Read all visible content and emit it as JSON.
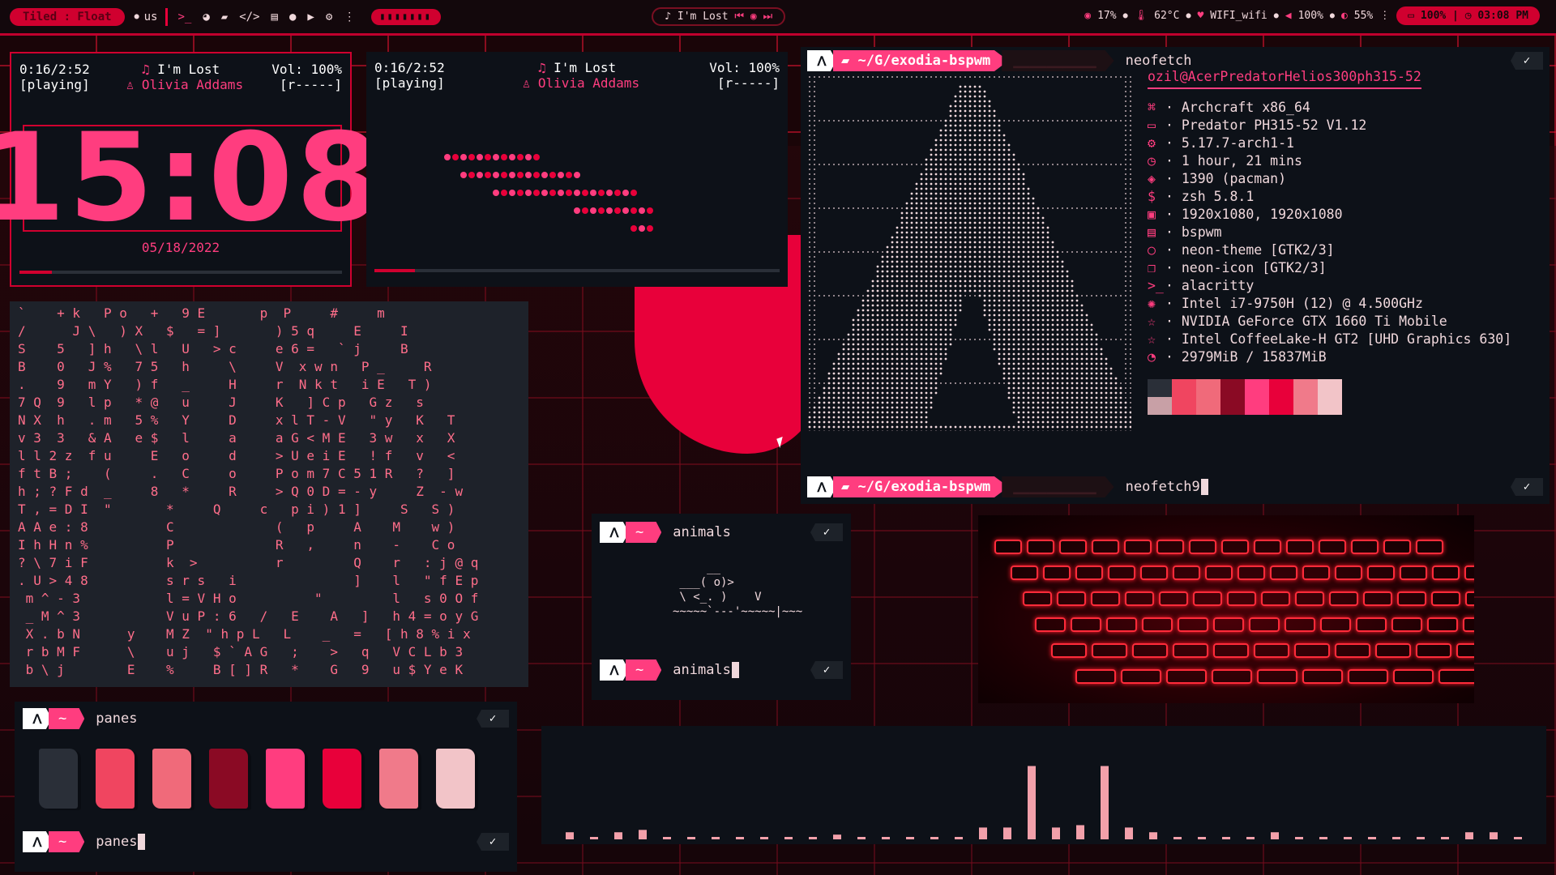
{
  "colors": {
    "accent": "#ff3d7f",
    "red": "#d0002f",
    "bg": "#0d1118"
  },
  "topbar": {
    "layout": "Tiled : Float",
    "kbd_layout": "us",
    "icons": [
      "terminal-icon",
      "firefox-icon",
      "folder-icon",
      "code-icon",
      "notes-icon",
      "chat-icon",
      "youtube-icon",
      "settings-icon",
      "more-icon"
    ],
    "now_playing": "I'm Lost",
    "cpu": "17%",
    "temp": "62°C",
    "wifi": "WIFI_wifi",
    "volume": "100%",
    "brightness": "55%",
    "battery": "100%",
    "time": "03:08 PM"
  },
  "player1": {
    "time": "0:16/2:52",
    "status": "[playing]",
    "title": "I'm Lost",
    "artist": "Olivia Addams",
    "vol": "Vol: 100%",
    "repeat": "[r-----]",
    "progress": 0.1,
    "clock": "15:08",
    "date": "05/18/2022"
  },
  "player2": {
    "time": "0:16/2:52",
    "status": "[playing]",
    "title": "I'm Lost",
    "artist": "Olivia Addams",
    "vol": "Vol: 100%",
    "repeat": "[r-----]",
    "progress": 0.1
  },
  "neofetch": {
    "path": "~/G/exodia-bspwm",
    "command": "neofetch",
    "command2": "neofetch9",
    "user_host": "ozil@AcerPredatorHelios300ph315-52",
    "info": [
      {
        "icon": "⌘",
        "text": "Archcraft x86_64"
      },
      {
        "icon": "▭",
        "text": "Predator PH315-52 V1.12"
      },
      {
        "icon": "⚙",
        "text": "5.17.7-arch1-1"
      },
      {
        "icon": "◷",
        "text": "1 hour, 21 mins"
      },
      {
        "icon": "◈",
        "text": "1390 (pacman)"
      },
      {
        "icon": "$",
        "text": "zsh 5.8.1"
      },
      {
        "icon": "▣",
        "text": "1920x1080, 1920x1080"
      },
      {
        "icon": "▤",
        "text": "bspwm"
      },
      {
        "icon": "○",
        "text": "neon-theme [GTK2/3]"
      },
      {
        "icon": "❐",
        "text": "neon-icon [GTK2/3]"
      },
      {
        "icon": ">_",
        "text": "alacritty"
      },
      {
        "icon": "✺",
        "text": "Intel i7-9750H (12) @ 4.500GHz"
      },
      {
        "icon": "☆",
        "text": "NVIDIA GeForce GTX 1660 Ti Mobile"
      },
      {
        "icon": "☆",
        "text": "Intel CoffeeLake-H GT2 [UHD Graphics 630]"
      },
      {
        "icon": "◔",
        "text": "2979MiB / 15837MiB"
      }
    ],
    "palette": [
      "#2a2f38",
      "#f04560",
      "#f06a7a",
      "#8a0a24",
      "#ff3d7f",
      "#e8003a",
      "#f07a8a",
      "#f2c4c8"
    ]
  },
  "animals": {
    "prompt": "~",
    "command": "animals",
    "art": "     __\n ___( o)>\n \\ <_. )    V\n~~~~~`---'~~~~~|~~~"
  },
  "panes": {
    "prompt": "~",
    "command": "panes",
    "colors": [
      "#2a2f38",
      "#f04560",
      "#f06a7a",
      "#8a0a24",
      "#ff3d7f",
      "#e8003a",
      "#f07a8a",
      "#f2c4c8"
    ]
  },
  "matrix": "`    + k   P o   +   9 E       p  P     #     m\n/      J \\   ) X   $   = ]       ) 5 q     E     I\nS    5   ] h   \\ l   U   > c     e 6 =   ` j     B\nB    0   J %   7 5   h     \\     V  x w n   P _     R\n.    9   m Y   ) f   _     H     r  N k t   i E   T )\n7 Q  9   l p   * @   u     J     K   ] C p   G z   s\nN X  h   . m   5 %   Y     D     x l T - V   \" y   K   T\nv 3  3   & A   e $   l     a     a G < M E   3 w   x   X\nl l 2 z  f u     E   o     d     > U e i E   ! f   v   <\nf t B ;    (     .   C     o     P o m 7 C 5 1 R   ?   ]\nh ; ? F d  _     8   *     R     > Q 0 D = - y     Z  - w\nT , = D I  \"       *     Q     c   p i ) 1 ]     S   S )\nA A e : 8          C             (   p     A    M    w )\nI h H n %          P             R   ,     n    -    C o\n? \\ 7 i F          k  >          r         Q    r   : j @ q\n. U > 4 8          s r s   i               ]    l   \" f E p\n m ^ - 3           l = V H o          \"         l   s 0 O f\n _ M ^ 3           V u P : 6   /   E    A   ]   h 4 = o y G\n X . b N      y    M Z  \" h p L   L    _   =   [ h 8 % i x\n r b M F      \\    u j   $ ` A G   ;    >   q   V C L b 3\n b \\ j        E    %     B [ ] R   *    G   9   u $ Y e K",
  "bars": [
    0.06,
    0.02,
    0.06,
    0.08,
    0.02,
    0.02,
    0.02,
    0.02,
    0.02,
    0.02,
    0.02,
    0.04,
    0.02,
    0.02,
    0.02,
    0.02,
    0.02,
    0.1,
    0.1,
    0.62,
    0.1,
    0.12,
    0.62,
    0.1,
    0.06,
    0.02,
    0.02,
    0.02,
    0.02,
    0.06,
    0.02,
    0.02,
    0.02,
    0.02,
    0.02,
    0.02,
    0.02,
    0.06,
    0.06,
    0.02
  ]
}
